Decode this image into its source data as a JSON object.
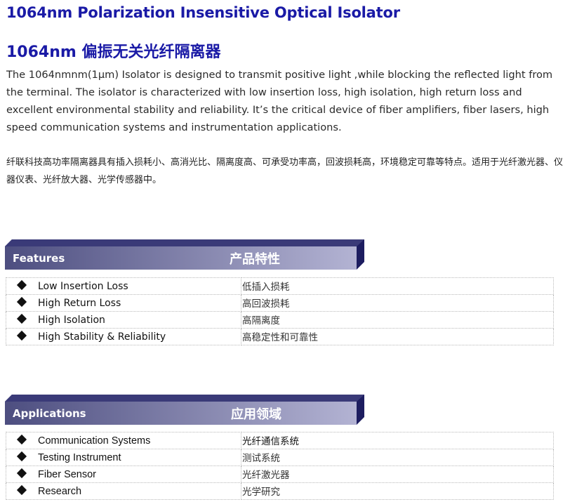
{
  "title_en": "1064nm Polarization Insensitive Optical Isolator",
  "title_cn": "1064nm 偏振无关光纤隔离器",
  "intro_en": "The 1064nmnm(1μm) Isolator is designed to transmit positive light ,while blocking the reflected light from the terminal. The isolator is characterized with low insertion loss, high isolation, high return loss and excellent environmental stability and reliability. It’s the critical device of fiber amplifiers, fiber lasers, high speed communication systems and instrumentation applications.",
  "intro_cn": "纤联科技高功率隔离器具有插入损耗小、高消光比、隔离度高、可承受功率高，回波损耗高，环境稳定可靠等特点。适用于光纤激光器、仪器仪表、光纤放大器、光学传感器中。",
  "features": {
    "header_en": "Features",
    "header_cn": "产品特性",
    "rows": [
      {
        "en": "Low Insertion Loss",
        "cn": "低插入损耗"
      },
      {
        "en": "High Return Loss",
        "cn": "高回波损耗"
      },
      {
        "en": "High Isolation",
        "cn": "高隔离度"
      },
      {
        "en": "High Stability & Reliability",
        "cn": "高稳定性和可靠性"
      }
    ]
  },
  "applications": {
    "header_en": "Applications",
    "header_cn": "应用领域",
    "rows": [
      {
        "en": "Communication Systems",
        "cn": "光纤通信系统"
      },
      {
        "en": "Testing Instrument",
        "cn": "测试系统"
      },
      {
        "en": "Fiber Sensor",
        "cn": "光纤激光器"
      },
      {
        "en": "Research",
        "cn": "光学研究"
      }
    ]
  },
  "colors": {
    "title": "#1a1aa6",
    "bar_dark": "#4d4e80",
    "bar_light": "#b3b3d3",
    "bar_shadow": "#1d1d60"
  }
}
